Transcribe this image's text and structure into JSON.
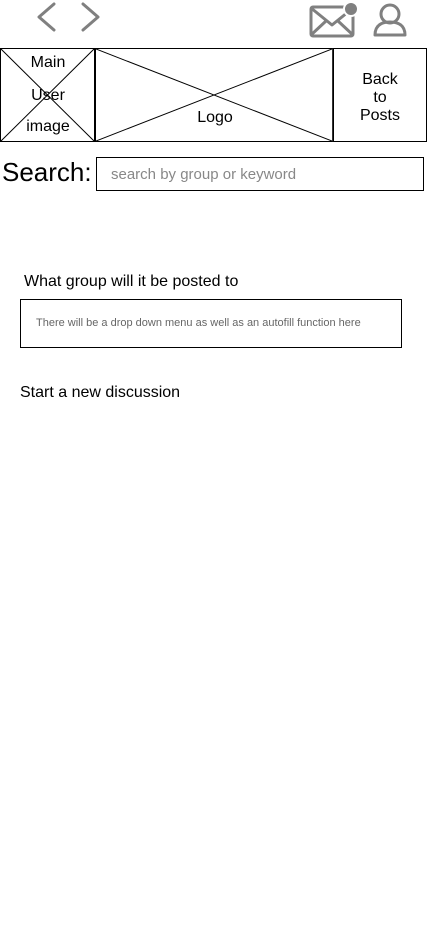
{
  "nav": {
    "back_icon": "chevron-left-icon",
    "forward_icon": "chevron-right-icon",
    "mail_icon": "mail-notification-icon",
    "profile_icon": "user-icon",
    "icon_color": "#808080"
  },
  "header": {
    "user_image_lines": [
      "Main",
      "User",
      "image"
    ],
    "logo_label": "Logo",
    "back_button_lines": [
      "Back",
      "to",
      "Posts"
    ]
  },
  "search": {
    "label": "Search:",
    "placeholder": "search by group or keyword",
    "value": ""
  },
  "group": {
    "heading": "What group will it be posted to",
    "select_placeholder": "There will be a drop down menu as well as an autofill function here"
  },
  "discussion": {
    "start_label": "Start a new discussion"
  }
}
